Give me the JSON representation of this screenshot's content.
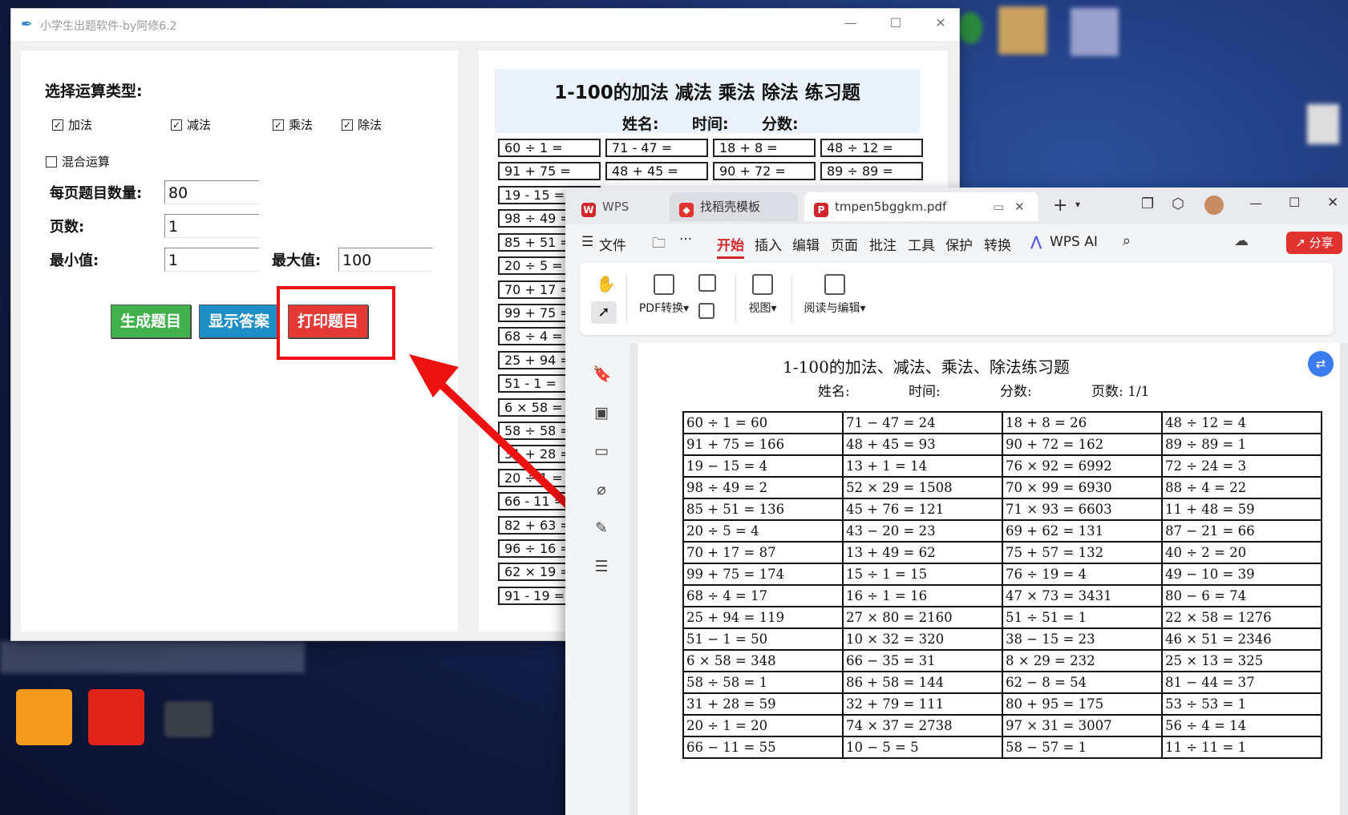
{
  "app": {
    "title": "小学生出题软件-by阿修6.2",
    "section_title": "选择运算类型:",
    "operations": [
      {
        "label": "加法",
        "checked": true
      },
      {
        "label": "减法",
        "checked": true
      },
      {
        "label": "乘法",
        "checked": true
      },
      {
        "label": "除法",
        "checked": true
      }
    ],
    "mixed": {
      "label": "混合运算",
      "checked": false
    },
    "per_page_label": "每页题目数量:",
    "per_page_value": "80",
    "pages_label": "页数:",
    "pages_value": "1",
    "min_label": "最小值:",
    "min_value": "1",
    "max_label": "最大值:",
    "max_value": "100",
    "buttons": {
      "generate": "生成题目",
      "answers": "显示答案",
      "print": "打印题目"
    },
    "colors": {
      "generate": "#43b14b",
      "answers": "#1d8fc6",
      "print": "#e53935",
      "highlight": "#ee1111"
    }
  },
  "preview": {
    "title": "1-100的加法 减法 乘法 除法 练习题",
    "name_label": "姓名:",
    "time_label": "时间:",
    "score_label": "分数:",
    "row1": [
      "60 ÷ 1 =",
      "71 - 47 =",
      "18 + 8 =",
      "48 ÷ 12 ="
    ],
    "row2": [
      "91 + 75 =",
      "48 + 45 =",
      "90 + 72 =",
      "89 ÷ 89 ="
    ],
    "col1": [
      "19 - 15 =",
      "98 ÷ 49 =",
      "85 + 51 =",
      "20 ÷ 5 =",
      "70 + 17 =",
      "99 + 75 =",
      "68 ÷ 4 =",
      "25 + 94 =",
      "51 - 1 =",
      "6 × 58 =",
      "58 ÷ 58 =",
      "31 + 28 =",
      "20 ÷ 1 =",
      "66 - 11 =",
      "82 + 63 =",
      "96 ÷ 16 =",
      "62 × 19 =",
      "91 - 19 ="
    ]
  },
  "wps": {
    "tabs": [
      {
        "label": "WPS Office"
      },
      {
        "label": "找稻壳模板"
      },
      {
        "label": "tmpen5bggkm.pdf"
      }
    ],
    "menu": [
      "文件",
      "开始",
      "插入",
      "编辑",
      "页面",
      "批注",
      "工具",
      "保护",
      "转换",
      "WPS AI"
    ],
    "share": "分享",
    "toolbar": {
      "pdf_convert": "PDF转换",
      "view": "视图",
      "read_edit": "阅读与编辑"
    },
    "doc": {
      "title": "1-100的加法、减法、乘法、除法练习题",
      "name_label": "姓名:",
      "time_label": "时间:",
      "score_label": "分数:",
      "pages_label": "页数: 1/1",
      "rows": [
        [
          "60 ÷ 1 =  60",
          "71 − 47 =  24",
          "18 + 8 =  26",
          "48 ÷ 12 =  4"
        ],
        [
          "91 + 75 =  166",
          "48 + 45 =  93",
          "90 + 72 =  162",
          "89 ÷ 89 =  1"
        ],
        [
          "19 − 15 =  4",
          "13 + 1 =  14",
          "76 × 92 =  6992",
          "72 ÷ 24 =  3"
        ],
        [
          "98 ÷ 49 =  2",
          "52 × 29 =  1508",
          "70 × 99 =  6930",
          "88 ÷ 4 =  22"
        ],
        [
          "85 + 51 =  136",
          "45 + 76 =  121",
          "71 × 93 =  6603",
          "11 + 48 =  59"
        ],
        [
          "20 ÷ 5 =  4",
          "43 − 20 =  23",
          "69 + 62 =  131",
          "87 − 21 =  66"
        ],
        [
          "70 + 17 =  87",
          "13 + 49 =  62",
          "75 + 57 =  132",
          "40 ÷ 2 =  20"
        ],
        [
          "99 + 75 =  174",
          "15 ÷ 1 =  15",
          "76 ÷ 19 =  4",
          "49 − 10 =  39"
        ],
        [
          "68 ÷ 4 =  17",
          "16 ÷ 1 =  16",
          "47 × 73 =  3431",
          "80 − 6 =  74"
        ],
        [
          "25 + 94 =  119",
          "27 × 80 =  2160",
          "51 ÷ 51 =  1",
          "22 × 58 =  1276"
        ],
        [
          "51 − 1 =  50",
          "10 × 32 =  320",
          "38 − 15 =  23",
          "46 × 51 =  2346"
        ],
        [
          "6 × 58 =  348",
          "66 − 35 =  31",
          "8 × 29 =  232",
          "25 × 13 =  325"
        ],
        [
          "58 ÷ 58 =  1",
          "86 + 58 =  144",
          "62 − 8 =  54",
          "81 − 44 =  37"
        ],
        [
          "31 + 28 =  59",
          "32 + 79 =  111",
          "80 + 95 =  175",
          "53 ÷ 53 =  1"
        ],
        [
          "20 ÷ 1 =  20",
          "74 × 37 =  2738",
          "97 × 31 =  3007",
          "56 ÷ 4 =  14"
        ],
        [
          "66 − 11 =  55",
          "10 − 5 =  5",
          "58 − 57 =  1",
          "11 ÷ 11 =  1"
        ]
      ]
    }
  }
}
